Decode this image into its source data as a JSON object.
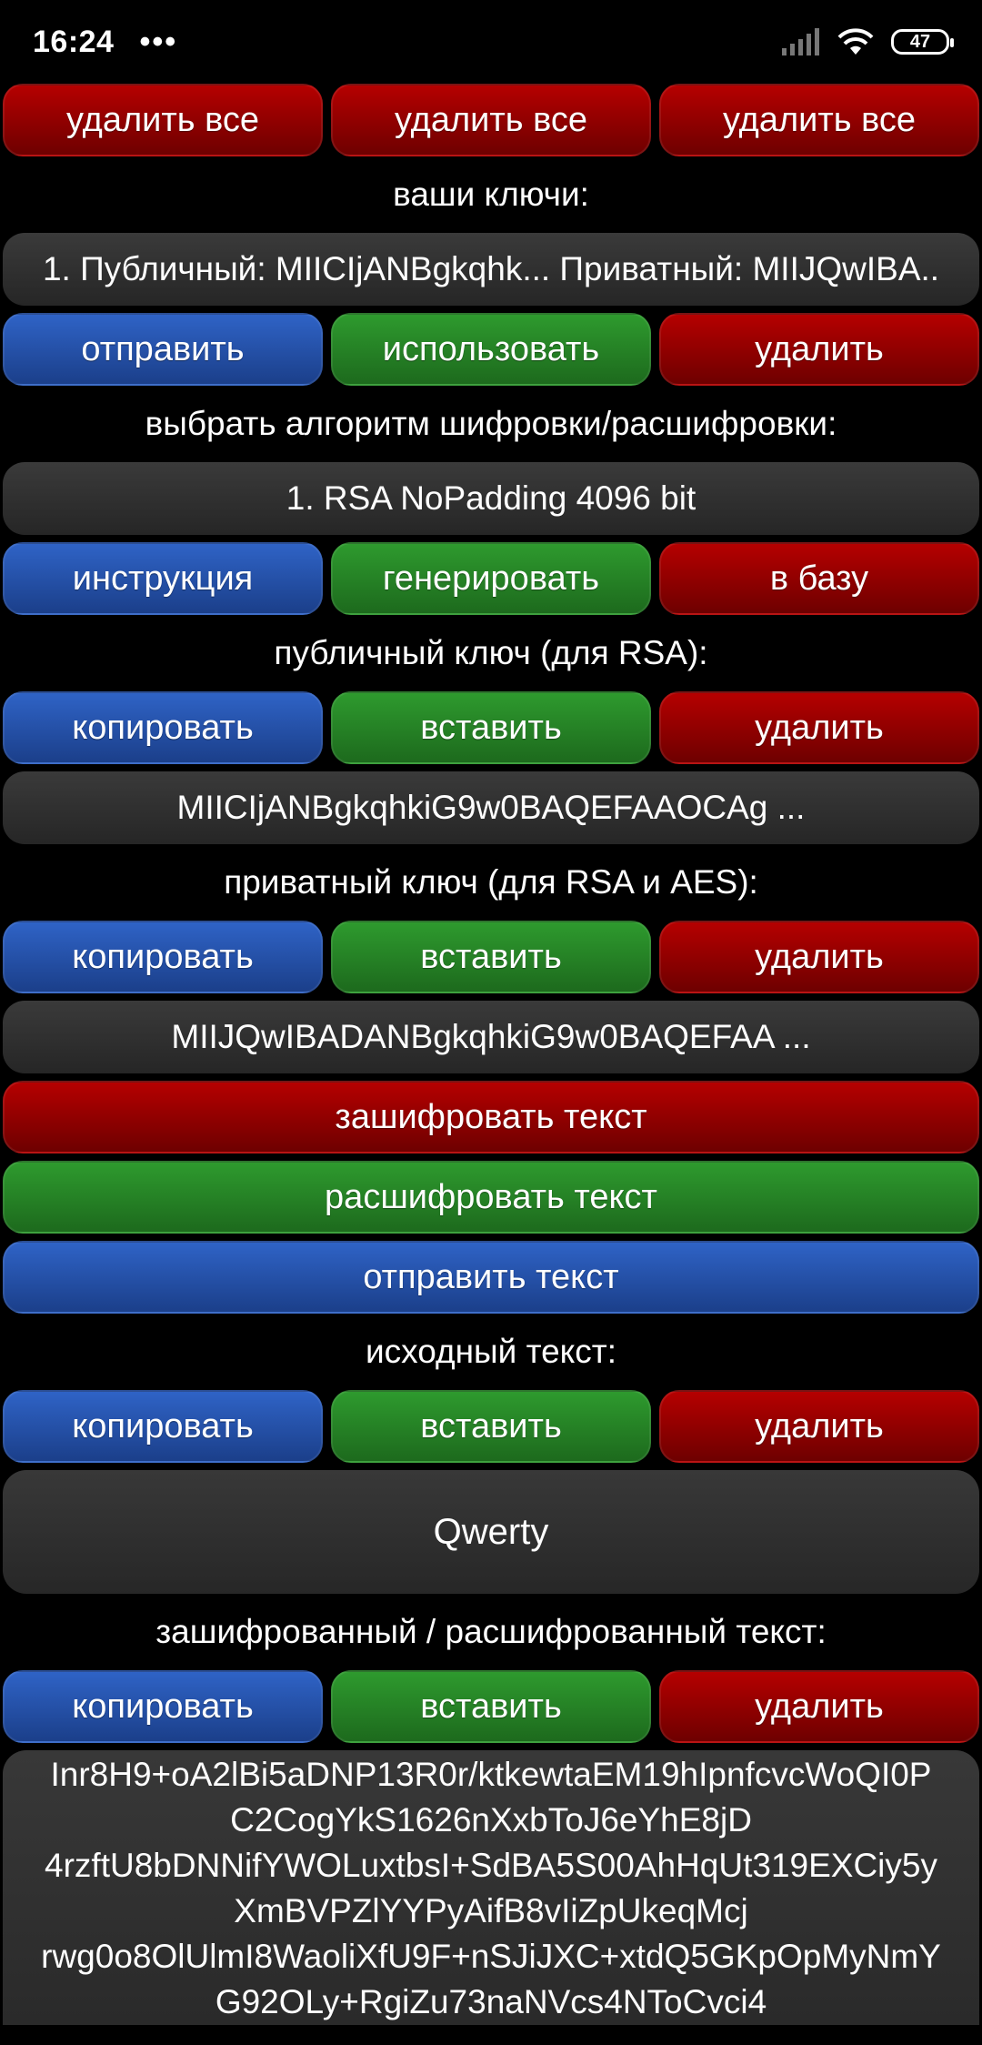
{
  "status": {
    "time": "16:24",
    "dots": "•••",
    "battery": "47"
  },
  "row_delete_all": {
    "b1": "удалить все",
    "b2": "удалить все",
    "b3": "удалить все"
  },
  "keys_label": "ваши ключи:",
  "keys_item": "1. Публичный: MIICIjANBgkqhk... Приватный: MIIJQwIBA..",
  "row_keys": {
    "send": "отправить",
    "use": "использовать",
    "delete": "удалить"
  },
  "algo_label": "выбрать алгоритм шифровки/расшифровки:",
  "algo_value": "1. RSA NoPadding 4096 bit",
  "row_algo": {
    "instruction": "инструкция",
    "generate": "генерировать",
    "to_db": "в базу"
  },
  "public_label": "публичный ключ (для RSA):",
  "row_public": {
    "copy": "копировать",
    "paste": "вставить",
    "delete": "удалить"
  },
  "public_value": "MIICIjANBgkqhkiG9w0BAQEFAAOCAg ...",
  "private_label": "приватный ключ (для RSA и AES):",
  "row_private": {
    "copy": "копировать",
    "paste": "вставить",
    "delete": "удалить"
  },
  "private_value": "MIIJQwIBADANBgkqhkiG9w0BAQEFAA ...",
  "encrypt_btn": "зашифровать текст",
  "decrypt_btn": "расшифровать текст",
  "send_text_btn": "отправить текст",
  "source_label": "исходный текст:",
  "row_source": {
    "copy": "копировать",
    "paste": "вставить",
    "delete": "удалить"
  },
  "source_value": "Qwerty",
  "result_label": "зашифрованный / расшифрованный текст:",
  "row_result": {
    "copy": "копировать",
    "paste": "вставить",
    "delete": "удалить"
  },
  "result_lines": [
    "Inr8H9+oA2lBi5aDNP13R0r/ktkewtaEM19hIpnfcvcWoQI0P",
    "C2CogYkS1626nXxbToJ6eYhE8jD",
    "4rzftU8bDNNifYWOLuxtbsI+SdBA5S00AhHqUt319EXCiy5y",
    "XmBVPZlYYPyAifB8vIiZpUkeqMcj",
    "rwg0o8OlUlmI8WaoliXfU9F+nSJiJXC+xtdQ5GKpOpMyNmY",
    "G92OLy+RgiZu73naNVcs4NToCvci4"
  ]
}
